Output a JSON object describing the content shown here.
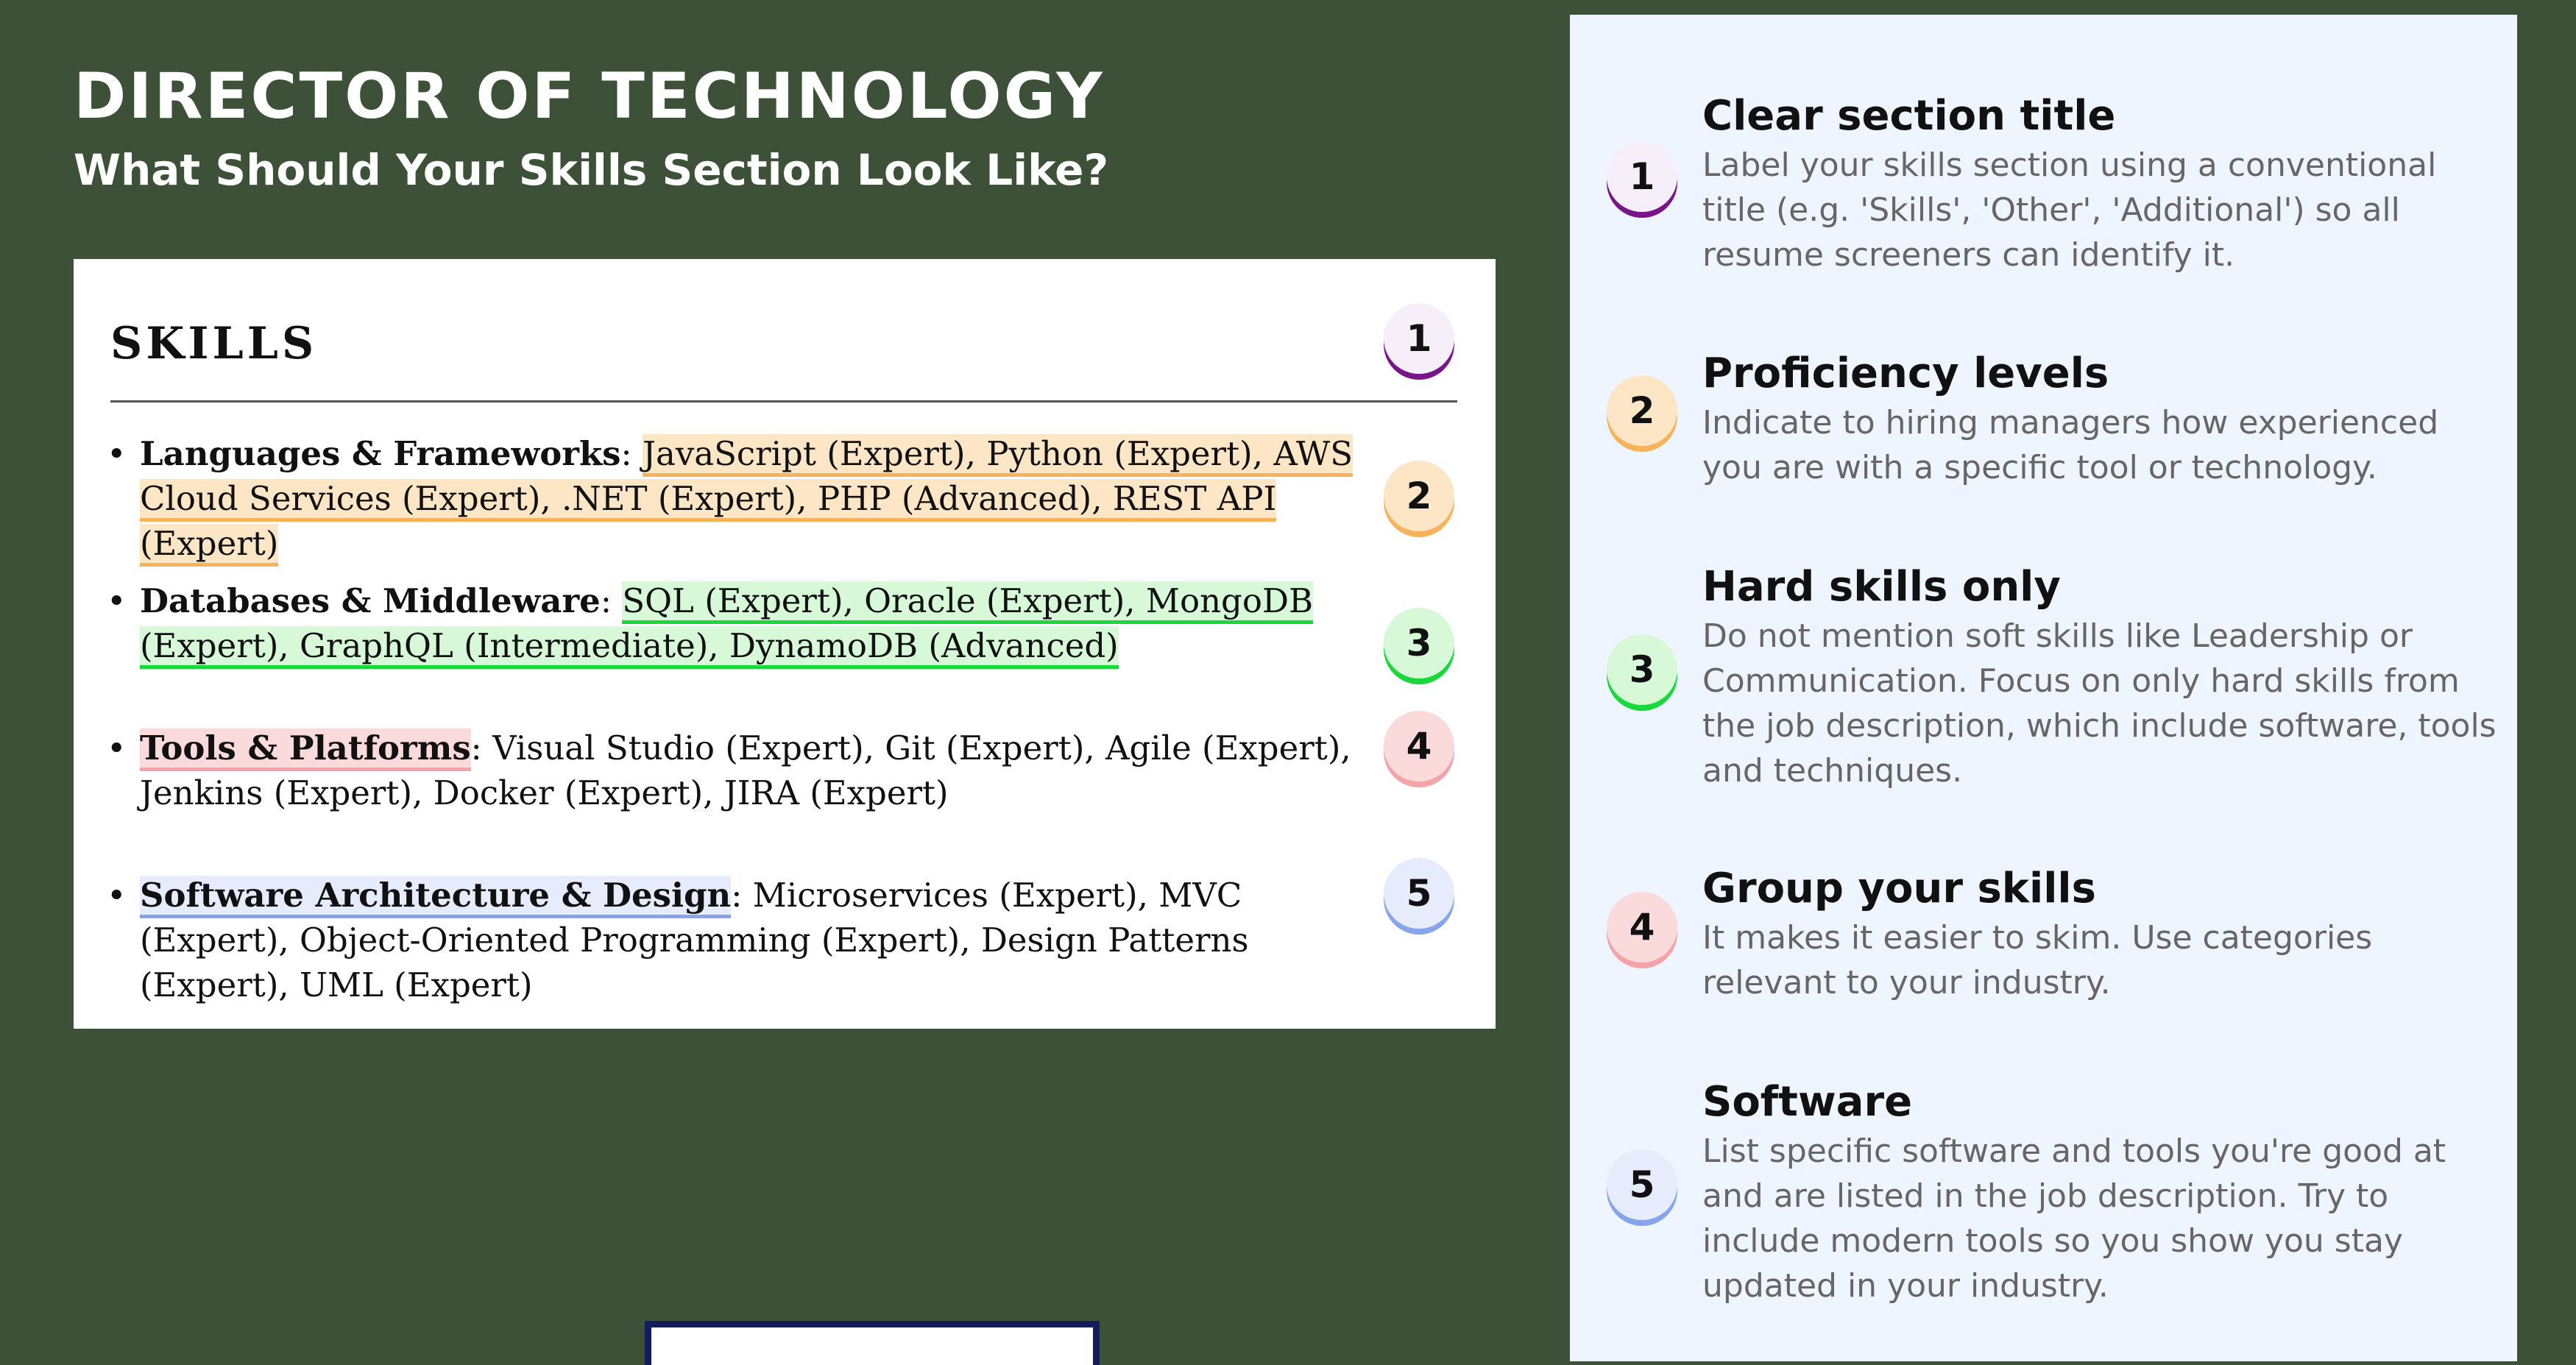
{
  "header": {
    "title": "DIRECTOR OF TECHNOLOGY",
    "subtitle_before": "What Should Your ",
    "subtitle_bold": "Skills",
    "subtitle_after": " Section Look Like?"
  },
  "resume": {
    "heading": "SKILLS",
    "bullet": "•",
    "skills": [
      {
        "category": "Languages & Frameworks",
        "sep": ": ",
        "items": "JavaScript (Expert), Python (Expert), AWS Cloud Services (Expert), .NET (Expert), PHP (Advanced), REST API (Expert)"
      },
      {
        "category": "Databases & Middleware",
        "sep": ": ",
        "items": "SQL (Expert), Oracle (Expert), MongoDB (Expert), GraphQL (Intermediate), DynamoDB (Advanced)"
      },
      {
        "category": "Tools & Platforms",
        "sep": ": ",
        "items": "Visual Studio (Expert), Git (Expert), Agile (Expert), Jenkins (Expert), Docker (Expert), JIRA (Expert)"
      },
      {
        "category": "Software Architecture & Design",
        "sep": ": ",
        "items": "Microservices (Expert), MVC (Expert), Object-Oriented Programming (Expert), Design Patterns (Expert), UML (Expert)"
      }
    ],
    "badges": [
      "1",
      "2",
      "3",
      "4",
      "5"
    ]
  },
  "tips": [
    {
      "number": "1",
      "title": "Clear section title",
      "text": "Label your skills section using a conventional title (e.g. 'Skills', 'Other', 'Additional') so all resume screeners can identify it."
    },
    {
      "number": "2",
      "title": "Proficiency levels",
      "text": "Indicate to hiring managers how experienced you are with a specific tool or technology."
    },
    {
      "number": "3",
      "title": "Hard skills only",
      "text": "Do not mention soft skills like Leadership or Communication. Focus on only hard skills from the job description, which include software, tools and techniques."
    },
    {
      "number": "4",
      "title": "Group your skills",
      "text": "It makes it easier to skim. Use categories relevant to your industry."
    },
    {
      "number": "5",
      "title": "Software",
      "text": "List specific software and tools you're good at and are listed in the job description. Try to include modern tools so you show you stay updated in your industry."
    }
  ],
  "colors": {
    "background": "#3c5137",
    "panel": "#eef5fe",
    "badge_1": "#7a1589",
    "badge_2": "#f6b35a",
    "badge_3": "#18d83a",
    "badge_4": "#f4a4a8",
    "badge_5": "#86a5ec"
  }
}
